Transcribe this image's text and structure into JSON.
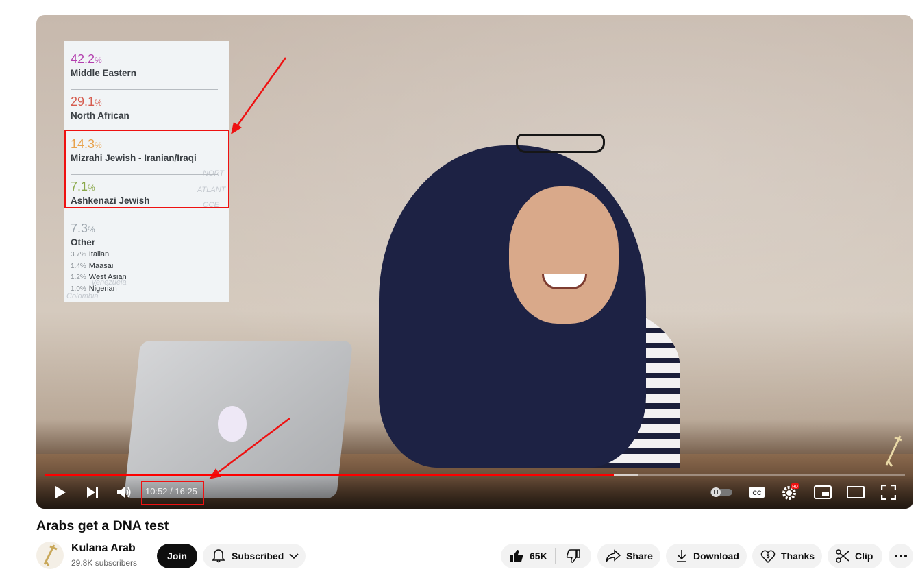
{
  "video": {
    "title": "Arabs get a DNA test",
    "current_time": "10:52",
    "separator": " / ",
    "duration": "16:25",
    "time_display": "10:52 / 16:25",
    "progress_fraction": 0.662,
    "buffered_fraction": 0.69
  },
  "dna_overlay": {
    "ethnicities": [
      {
        "percent": "42.2",
        "unit": "%",
        "name": "Middle Eastern",
        "color": "#b33fae"
      },
      {
        "percent": "29.1",
        "unit": "%",
        "name": "North African",
        "color": "#d65c4f"
      },
      {
        "percent": "14.3",
        "unit": "%",
        "name": "Mizrahi Jewish - Iranian/Iraqi",
        "color": "#e8a24c"
      },
      {
        "percent": "7.1",
        "unit": "%",
        "name": "Ashkenazi Jewish",
        "color": "#8aa84a"
      },
      {
        "percent": "7.3",
        "unit": "%",
        "name": "Other",
        "color": "#9aa3ab"
      }
    ],
    "other_breakdown": [
      {
        "percent": "3.7%",
        "name": "Italian"
      },
      {
        "percent": "1.4%",
        "name": "Maasai"
      },
      {
        "percent": "1.2%",
        "name": "West Asian"
      },
      {
        "percent": "1.0%",
        "name": "Nigerian"
      }
    ],
    "map_labels": [
      "NORT",
      "ATLANT",
      "OCE",
      "Venezuela",
      "Colombia"
    ]
  },
  "channel": {
    "name": "Kulana Arab",
    "subscribers": "29.8K subscribers"
  },
  "actions": {
    "join": "Join",
    "subscribed": "Subscribed",
    "likes": "65K",
    "share": "Share",
    "download": "Download",
    "thanks": "Thanks",
    "clip": "Clip"
  },
  "colors": {
    "progress_played": "#ff0000",
    "annotation": "#e11111"
  },
  "icons": {
    "play": "play-icon",
    "next": "next-icon",
    "volume": "volume-icon",
    "autoplay": "autoplay-toggle-icon",
    "captions": "captions-icon",
    "settings": "settings-icon",
    "miniplayer": "miniplayer-icon",
    "theater": "theater-icon",
    "fullscreen": "fullscreen-icon"
  }
}
